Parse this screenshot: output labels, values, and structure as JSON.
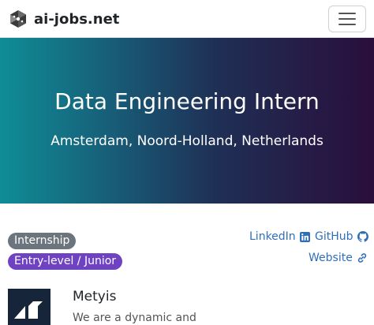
{
  "navbar": {
    "brand_name": "ai-jobs.net",
    "logo_icon": "brain-network-icon",
    "menu_icon": "hamburger-menu-icon"
  },
  "hero": {
    "title": "Data Engineering Intern",
    "location": "Amsterdam, Noord-Holland, Netherlands"
  },
  "badges": {
    "employment_type": "Internship",
    "level": "Entry-level / Junior"
  },
  "links": {
    "linkedin": "LinkedIn",
    "github": "GitHub",
    "website": "Website"
  },
  "company": {
    "name": "Metyis",
    "description": "We are a dynamic and"
  },
  "colors": {
    "hero_gradient_start": "#0f8d96",
    "hero_gradient_end": "#2a0e3c",
    "badge_type": "#6c757d",
    "badge_level": "#6f42c1",
    "link": "#2f6fba",
    "company_logo_bg": "#17253a"
  }
}
